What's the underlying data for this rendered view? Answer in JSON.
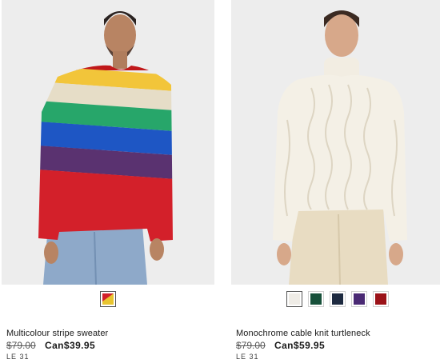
{
  "products": [
    {
      "name": "Multicolour stripe sweater",
      "old_price": "$79.00",
      "new_price": "Can$39.95",
      "brand": "LE 31",
      "swatch_colors": [
        "#e8c530"
      ],
      "image_icon": "model-stripe-sweater-photo"
    },
    {
      "name": "Monochrome cable knit turtleneck",
      "old_price": "$79.00",
      "new_price": "Can$59.95",
      "brand": "LE 31",
      "swatch_colors": [
        "#efece6",
        "#17503a",
        "#1d2a40",
        "#4a2a74",
        "#9b1218"
      ],
      "image_icon": "model-cable-knit-turtleneck-photo"
    }
  ]
}
